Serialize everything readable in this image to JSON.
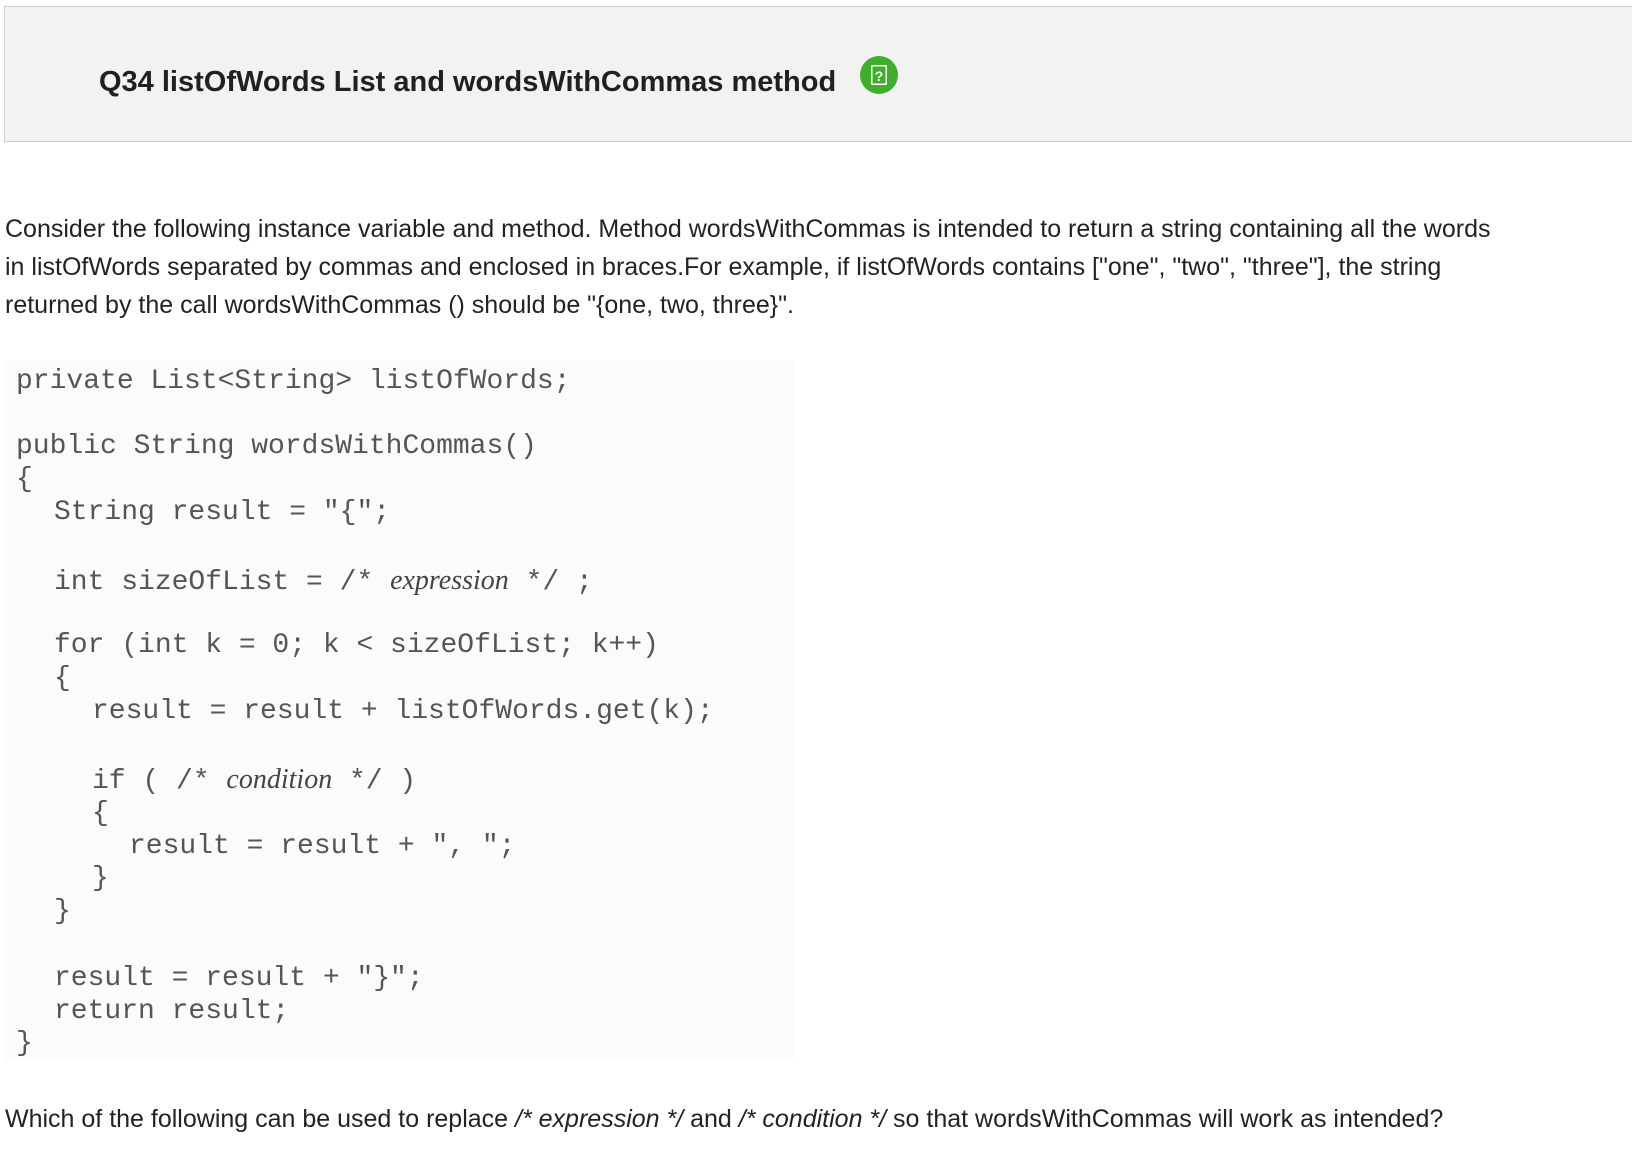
{
  "header": {
    "title": "Q34 listOfWords List and wordsWithCommas method",
    "help_icon": "help-notebook-icon",
    "help_icon_color": "#3fae2a",
    "help_icon_glyph": "?"
  },
  "intro": {
    "lines": [
      "Consider the following instance variable and method. Method wordsWithCommas is intended to return a string containing all the words",
      "in listOfWords separated by commas and enclosed in braces.For example, if listOfWords contains [\"one\", \"two\", \"three\"], the string",
      "returned by the call wordsWithCommas () should be \"{one, two, three}\"."
    ]
  },
  "code": {
    "line_1": "private List<String> listOfWords;",
    "line_2": "public String wordsWithCommas()",
    "line_3": "{",
    "line_4": "String result = \"{\";",
    "line_5_start": "int sizeOfList = /* ",
    "line_5_placeholder": "expression",
    "line_5_end": " */ ;",
    "line_6": "for (int k = 0; k < sizeOfList; k++)",
    "line_7": "{",
    "line_8": "result = result + listOfWords.get(k);",
    "line_9_start": "if ( /* ",
    "line_9_placeholder": "condition",
    "line_9_end": " */ )",
    "line_10": "{",
    "line_11": "result = result + \", \";",
    "line_12": "}",
    "line_13": "}",
    "line_14": "result = result + \"}\";",
    "line_15": "return result;",
    "line_16": "}"
  },
  "question": {
    "part_1": "Which of the following can be used to replace ",
    "expression_ref": "/* expression */",
    "part_2": " and ",
    "condition_ref": "/* condition */",
    "part_3": " so that wordsWithCommas will work as intended?"
  }
}
